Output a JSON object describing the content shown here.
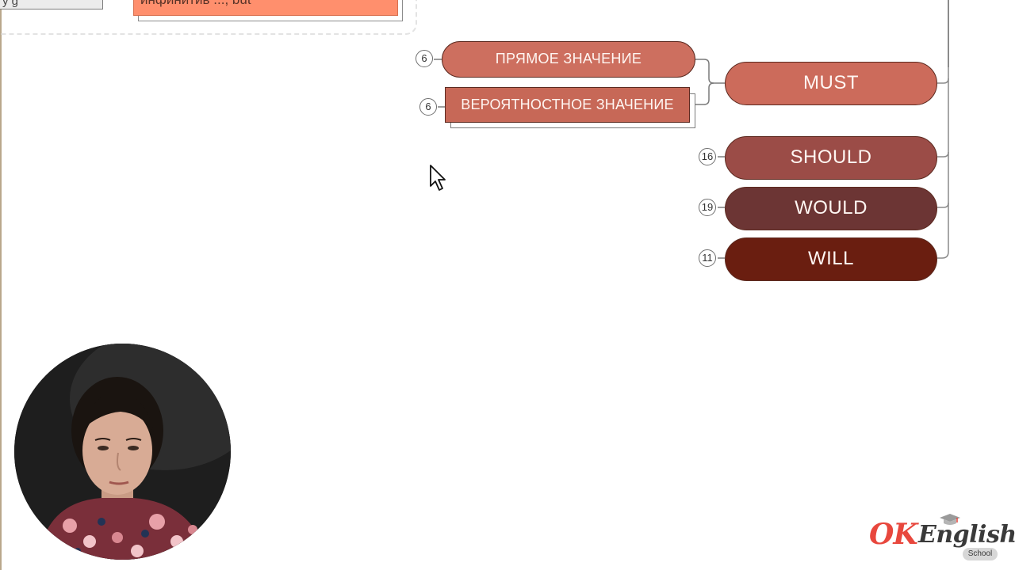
{
  "top_fragment": {
    "gray_box_text": "y g",
    "orange_box_text": "инфинитив ..., but"
  },
  "mindmap": {
    "direct_meaning": {
      "label": "ПРЯМОЕ ЗНАЧЕНИЕ",
      "count": "6",
      "color": "#cd6f5f"
    },
    "probable_meaning": {
      "label": "ВЕРОЯТНОСТНОЕ ЗНАЧЕНИЕ",
      "count": "6",
      "color": "#c76857"
    },
    "modals": [
      {
        "label": "MUST",
        "count": "",
        "color": "#cc6b5b"
      },
      {
        "label": "SHOULD",
        "count": "16",
        "color": "#9b4c47"
      },
      {
        "label": "WOULD",
        "count": "19",
        "color": "#6c3534"
      },
      {
        "label": "WILL",
        "count": "11",
        "color": "#6a1e10"
      }
    ]
  },
  "logo": {
    "ok": "OK",
    "english": "English",
    "school": "School",
    "ok_color": "#e8473d"
  },
  "icons": {
    "cursor": "mouse-pointer-icon",
    "cap": "graduation-cap-icon"
  }
}
